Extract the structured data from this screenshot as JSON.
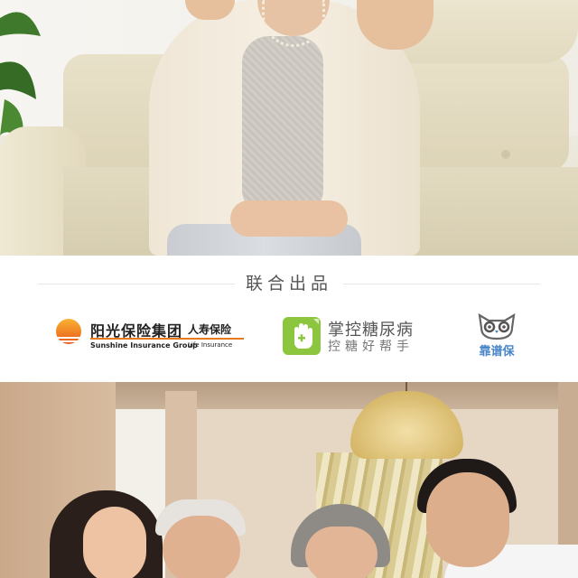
{
  "section": {
    "heading": "联合出品"
  },
  "logos": {
    "sunshine": {
      "name_cn": "阳光保险集团",
      "name_cn_sub": "人寿保险",
      "name_en": "Sunshine Insurance Group",
      "name_en_sub": "Life Insurance",
      "accent": "#e87a1e"
    },
    "zhangkong": {
      "name": "掌控糖尿病",
      "slogan": "控糖好帮手",
      "accent": "#8cc63f",
      "icon": "hand-plus-icon"
    },
    "kaopubao": {
      "name": "靠谱保",
      "accent": "#4a86c8",
      "icon": "owl-icon"
    }
  },
  "photos": {
    "top": "elderly-woman-on-sofa-photo",
    "bottom": "family-portrait-photo"
  }
}
